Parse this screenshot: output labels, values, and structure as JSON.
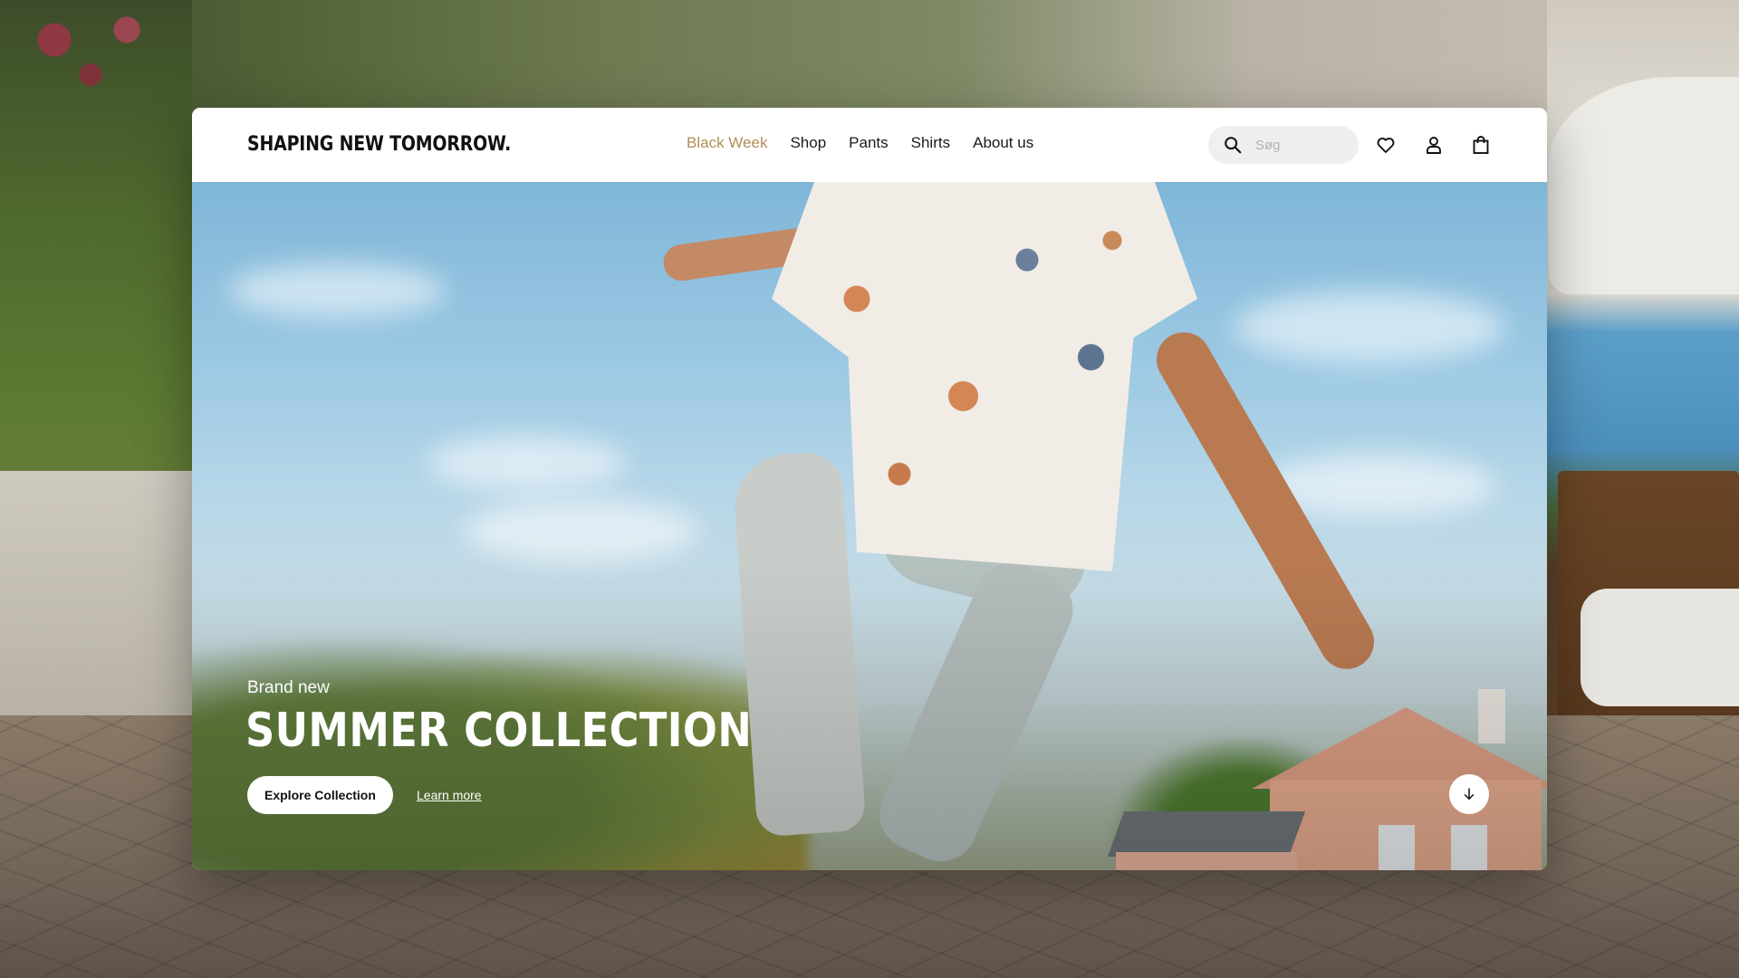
{
  "brand": {
    "logo_text": "SHAPING NEW TOMORROW."
  },
  "nav": {
    "items": [
      {
        "label": "Black Week",
        "active": true
      },
      {
        "label": "Shop",
        "active": false
      },
      {
        "label": "Pants",
        "active": false
      },
      {
        "label": "Shirts",
        "active": false
      },
      {
        "label": "About us",
        "active": false
      }
    ]
  },
  "search": {
    "placeholder": "Søg",
    "value": ""
  },
  "header_icons": [
    "search-icon",
    "heart-icon",
    "user-icon",
    "shopping-bag-icon"
  ],
  "hero": {
    "eyebrow": "Brand new",
    "headline": "SUMMER COLLECTION",
    "primary_cta": "Explore Collection",
    "secondary_link": "Learn more",
    "scroll_icon": "arrow-down-icon"
  },
  "colors": {
    "accent": "#b08d57",
    "text": "#111111",
    "surface": "#ffffff"
  }
}
